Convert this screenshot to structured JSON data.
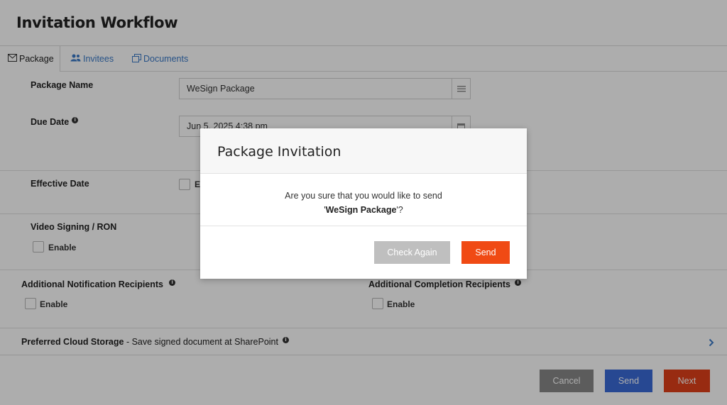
{
  "page": {
    "title": "Invitation Workflow"
  },
  "tabs": [
    {
      "label": "Package",
      "icon": "envelope-icon",
      "active": true
    },
    {
      "label": "Invitees",
      "icon": "users-icon",
      "active": false
    },
    {
      "label": "Documents",
      "icon": "documents-icon",
      "active": false
    }
  ],
  "form": {
    "package_name_label": "Package Name",
    "package_name_value": "WeSign Package",
    "due_date_label": "Due Date",
    "due_date_value": "Jun 5, 2025 4:38 pm",
    "effective_date_label": "Effective Date",
    "effective_date_checkbox_label": "En",
    "video_signing_label": "Video Signing / RON",
    "video_enable_label": "Enable",
    "additional_notification_label": "Additional Notification Recipients",
    "notification_enable_label": "Enable",
    "additional_completion_label": "Additional Completion Recipients",
    "completion_enable_label": "Enable",
    "cloud_storage_label": "Preferred Cloud Storage",
    "cloud_storage_sep": " - ",
    "cloud_storage_value": "Save signed document at SharePoint"
  },
  "footer": {
    "cancel_label": "Cancel",
    "send_label": "Send",
    "next_label": "Next"
  },
  "modal": {
    "title": "Package Invitation",
    "message_line1": "Are you sure that you would like to send",
    "quote_open": "'",
    "package_name": "WeSign Package",
    "quote_close": "'?",
    "check_again_label": "Check Again",
    "send_label": "Send"
  },
  "colors": {
    "accent_blue": "#3a7ac8",
    "send_orange": "#f04a14",
    "next_red": "#e0401a",
    "send_blue": "#3a6ad8"
  }
}
